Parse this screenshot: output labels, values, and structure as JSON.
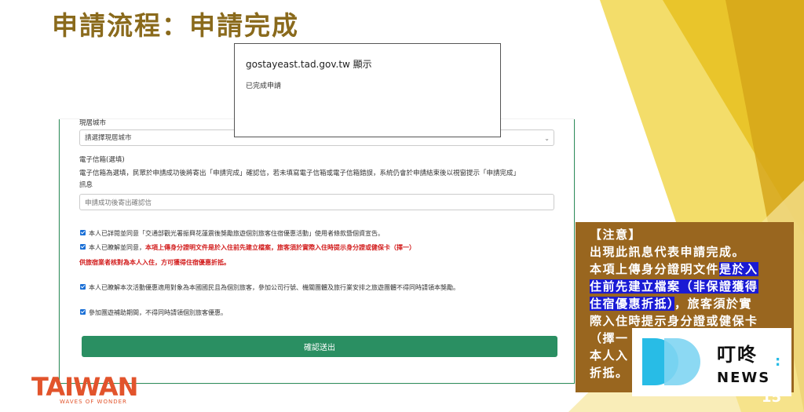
{
  "slide": {
    "title": "申請流程：申請完成",
    "page_number": "15"
  },
  "form": {
    "residence_label": "現居城市",
    "residence_select_value": "請選擇現居城市",
    "email_label": "電子信箱(選填)",
    "email_help_line1": "電子信箱為選填，民眾於申請成功後將寄出「申請完成」確認信，若未填寫電子信箱或電子信箱錯誤，系統仍會於申請結束後以視窗提示「申請完成」",
    "email_help_line2": "訊息",
    "email_placeholder": "申請成功後寄出確認信",
    "checks": {
      "c1": "本人已詳閱並同意「交通部觀光署振興花蓮震後獎勵旅遊個別旅客住宿優惠活動」使用者條款暨個資宣告。",
      "c2_prefix": "本人已瞭解並同意，",
      "c2_red": "本項上傳身分證明文件是於入住前先建立檔案，旅客須於實際入住時提示身分證或健保卡（擇一）",
      "c2_line2": "供旅宿業者核對為本人入住，方可獲得住宿優惠折抵。",
      "c3": "本人已瞭解本次活動優惠適用對象為本國國民且為個別旅客，參加公司行號、機關團體及旅行業安排之旅遊團體不得同時請領本獎勵。",
      "c4": "參加團遊補助期間，不得同時請領個別旅客優惠。"
    },
    "submit_label": "確認送出"
  },
  "dialog": {
    "host": "gostayeast.tad.gov.tw 顯示",
    "message": "已完成申請"
  },
  "note": {
    "heading": "【注意】",
    "l1": "出現此訊息代表申請完成。",
    "l2a": "本項上傳身分證明文件",
    "l2b": "是於入",
    "l3": "住前先建立檔案（非保證獲得",
    "l4a": "住宿優惠折抵）",
    "l4b": "，旅客須於實",
    "l5": "際入住時提示身分證或健保卡",
    "l6": "（擇一",
    "l7": "本人入",
    "l8": "折抵。"
  },
  "logo": {
    "zh": "叮咚",
    "en": "NEWS"
  },
  "brand": {
    "taiwan": "TAIWAN",
    "tagline": "WAVES OF WONDER"
  },
  "colors": {
    "title": "#8a6a1c",
    "note_bg": "#99661f",
    "submit": "#2a8f62",
    "highlight": "#1a1ad4",
    "required_text": "#d21c1c"
  }
}
